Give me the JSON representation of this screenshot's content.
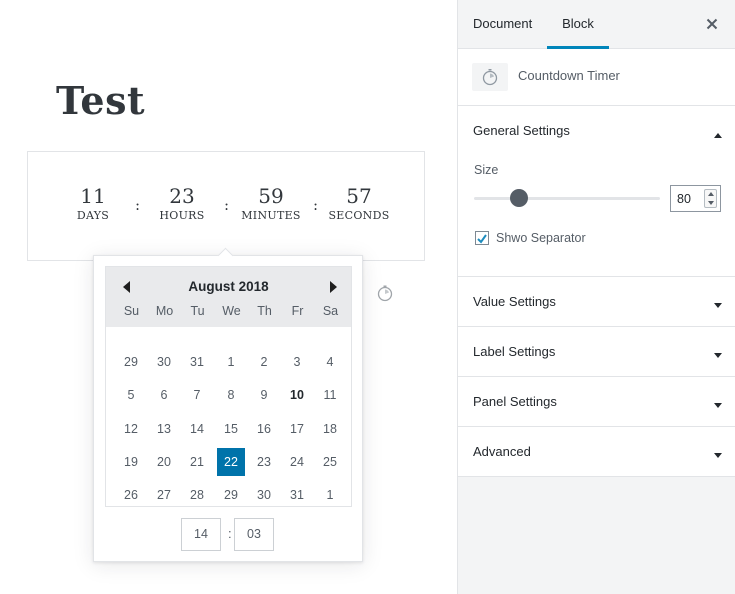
{
  "editor": {
    "title": "Test",
    "countdown": {
      "units": [
        {
          "value": "11",
          "label": "DAYS"
        },
        {
          "value": "23",
          "label": "HOURS"
        },
        {
          "value": "59",
          "label": "MINUTES"
        },
        {
          "value": "57",
          "label": "SECONDS"
        }
      ],
      "separator": ":"
    }
  },
  "datepicker": {
    "month_label": "August 2018",
    "weekdays": [
      "Su",
      "Mo",
      "Tu",
      "We",
      "Th",
      "Fr",
      "Sa"
    ],
    "weeks": [
      [
        "29",
        "30",
        "31",
        "1",
        "2",
        "3",
        "4"
      ],
      [
        "5",
        "6",
        "7",
        "8",
        "9",
        "10",
        "11"
      ],
      [
        "12",
        "13",
        "14",
        "15",
        "16",
        "17",
        "18"
      ],
      [
        "19",
        "20",
        "21",
        "22",
        "23",
        "24",
        "25"
      ],
      [
        "26",
        "27",
        "28",
        "29",
        "30",
        "31",
        "1"
      ]
    ],
    "today": "10",
    "selected": "22",
    "time": {
      "hours": "14",
      "minutes": "03",
      "separator": ":"
    }
  },
  "sidebar": {
    "tabs": {
      "document": "Document",
      "block": "Block"
    },
    "active_tab": "Block",
    "block_name": "Countdown Timer",
    "panels": [
      {
        "title": "General Settings",
        "open": true
      },
      {
        "title": "Value Settings",
        "open": false
      },
      {
        "title": "Label Settings",
        "open": false
      },
      {
        "title": "Panel Settings",
        "open": false
      },
      {
        "title": "Advanced",
        "open": false
      }
    ],
    "general": {
      "size_label": "Size",
      "size_value": "80",
      "separator_label": "Shwo Separator",
      "separator_checked": true
    }
  },
  "colors": {
    "accent": "#0085ba",
    "selected_day": "#0073aa",
    "text": "#23282d",
    "muted": "#555d66"
  },
  "icons": {
    "prev": "caret-left-icon",
    "next": "caret-right-icon",
    "close": "close-icon",
    "block": "stopwatch-icon",
    "panel_open": "caret-up-icon",
    "panel_closed": "caret-down-icon"
  }
}
